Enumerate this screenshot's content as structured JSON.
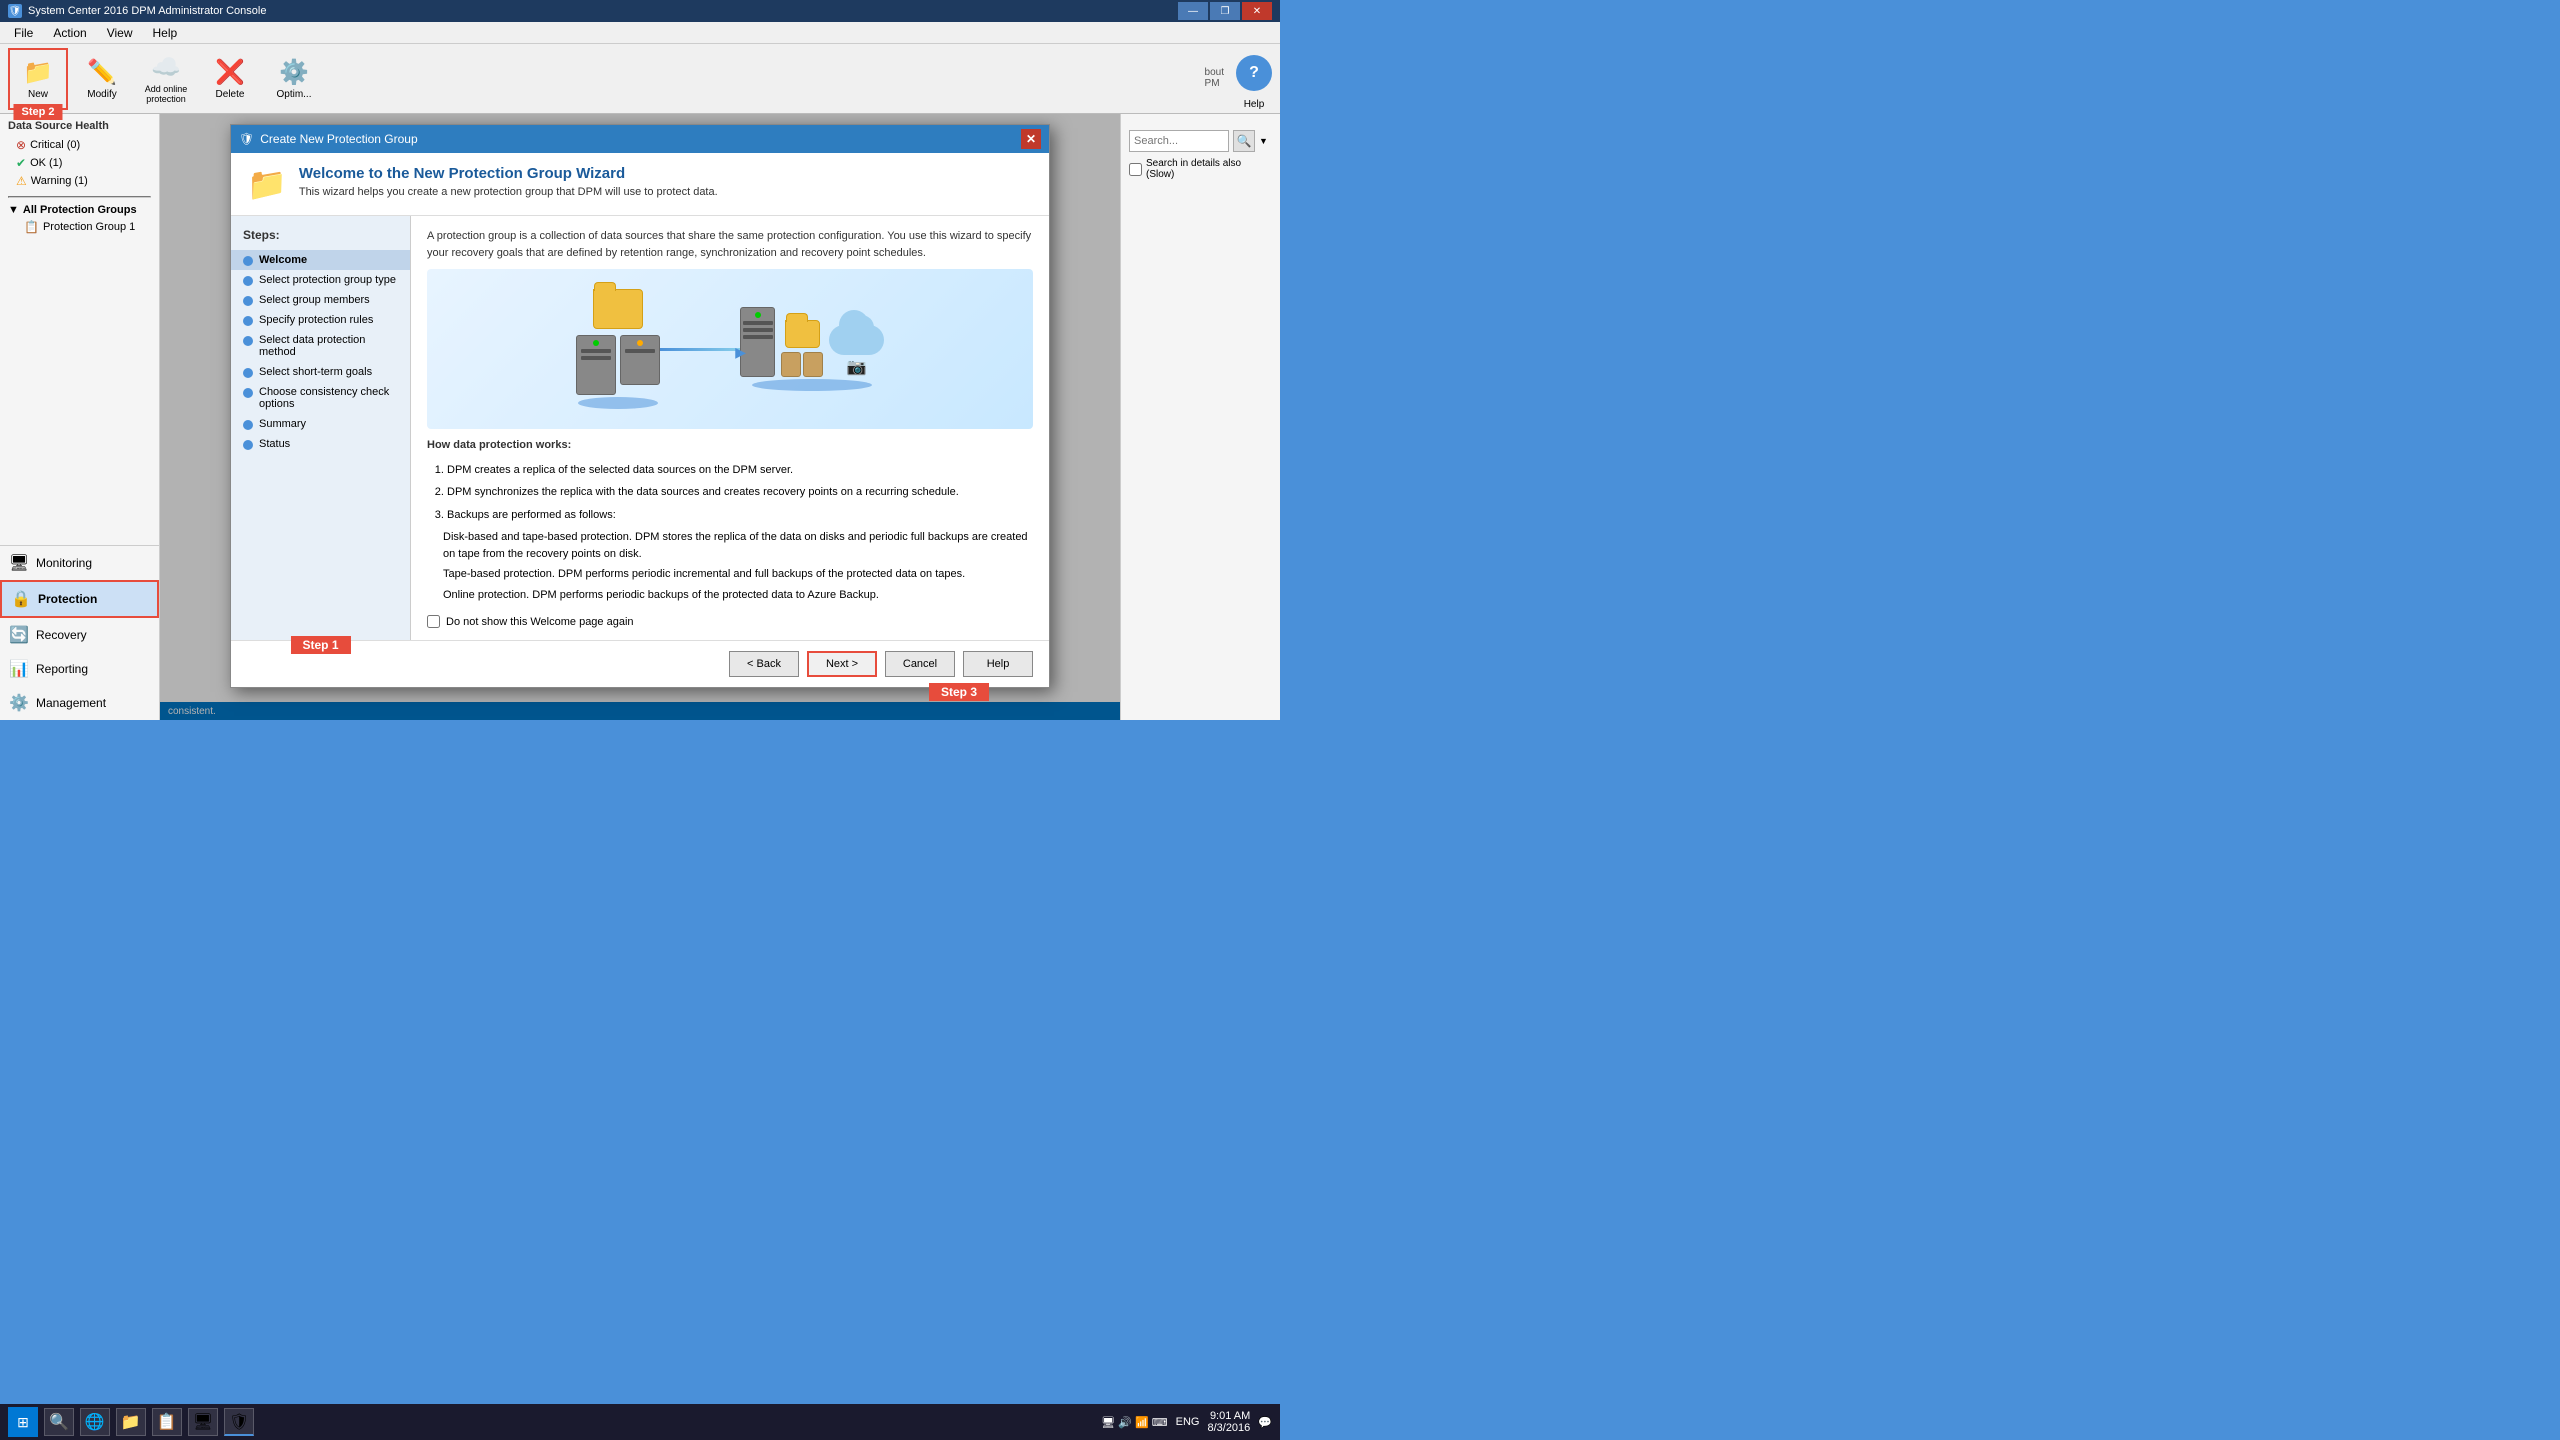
{
  "titleBar": {
    "title": "System Center 2016 DPM Administrator Console",
    "icon": "🛡",
    "controls": [
      "—",
      "❐",
      "✕"
    ]
  },
  "menuBar": {
    "items": [
      "File",
      "Action",
      "View",
      "Help"
    ]
  },
  "toolbar": {
    "buttons": [
      {
        "id": "new",
        "icon": "📁",
        "label": "New",
        "highlighted": true
      },
      {
        "id": "modify",
        "icon": "✏️",
        "label": "Modify"
      },
      {
        "id": "add-online",
        "icon": "☁️",
        "label": "Add online protection"
      },
      {
        "id": "delete",
        "icon": "❌",
        "label": "Delete"
      },
      {
        "id": "optimize",
        "icon": "⚙️",
        "label": "Optim..."
      }
    ],
    "step2": "Step 2"
  },
  "sidebar": {
    "sections": [
      {
        "title": "Data Source Health",
        "items": [
          {
            "label": "Critical (0)",
            "status": "critical",
            "icon": "⊗"
          },
          {
            "label": "OK (1)",
            "status": "ok",
            "icon": "✔"
          },
          {
            "label": "Warning (1)",
            "status": "warning",
            "icon": "⚠"
          }
        ]
      },
      {
        "title": "All Protection Groups",
        "items": [
          {
            "label": "Protection Group 1",
            "icon": "📋"
          }
        ]
      }
    ],
    "navItems": [
      {
        "id": "monitoring",
        "label": "Monitoring",
        "icon": "🖥"
      },
      {
        "id": "protection",
        "label": "Protection",
        "icon": "🔒",
        "active": true
      },
      {
        "id": "recovery",
        "label": "Recovery",
        "icon": "🔄"
      },
      {
        "id": "reporting",
        "label": "Reporting",
        "icon": "📊"
      },
      {
        "id": "management",
        "label": "Management",
        "icon": "⚙️"
      }
    ]
  },
  "modal": {
    "titleBar": {
      "icon": "🛡",
      "title": "Create New Protection Group"
    },
    "header": {
      "icon": "📁",
      "title": "Welcome to the New Protection Group Wizard",
      "subtitle": "This wizard helps you create a new protection group that DPM will use to protect data."
    },
    "steps": {
      "title": "Steps:",
      "items": [
        {
          "label": "Welcome",
          "active": true
        },
        {
          "label": "Select protection group type"
        },
        {
          "label": "Select group members"
        },
        {
          "label": "Specify protection rules"
        },
        {
          "label": "Select data protection method"
        },
        {
          "label": "Select short-term goals"
        },
        {
          "label": "Choose consistency check options"
        },
        {
          "label": "Summary"
        },
        {
          "label": "Status"
        }
      ],
      "step1Badge": "Step 1"
    },
    "content": {
      "intro": "A protection group is a collection of data sources that share the same protection configuration. You use this wizard to specify your recovery goals that are defined by retention range, synchronization and recovery point schedules.",
      "howTitle": "How data protection works:",
      "steps": [
        "DPM creates a replica of the selected data sources on the DPM server.",
        "DPM synchronizes the replica with the data sources and creates recovery points on a recurring schedule.",
        "Backups are performed as follows:"
      ],
      "backupTypes": [
        "Disk-based and tape-based protection. DPM stores the replica of the data on disks and periodic full backups are created on tape from the recovery points on disk.",
        "Tape-based protection. DPM performs periodic incremental and full backups of the protected data on tapes.",
        "Online protection. DPM performs periodic backups of the protected data to Azure Backup."
      ],
      "checkbox": "Do not show this Welcome page again"
    },
    "footer": {
      "buttons": [
        {
          "id": "back",
          "label": "< Back"
        },
        {
          "id": "next",
          "label": "Next >",
          "highlighted": true
        },
        {
          "id": "cancel",
          "label": "Cancel"
        },
        {
          "id": "help",
          "label": "Help"
        }
      ],
      "step3Badge": "Step 3"
    }
  },
  "statusBar": {
    "text": "consistent."
  },
  "taskbar": {
    "time": "9:01 AM",
    "date": "8/3/2016",
    "lang": "ENG",
    "apps": [
      "🔍",
      "🌐",
      "📁",
      "📋",
      "🖥",
      "🛡"
    ]
  }
}
